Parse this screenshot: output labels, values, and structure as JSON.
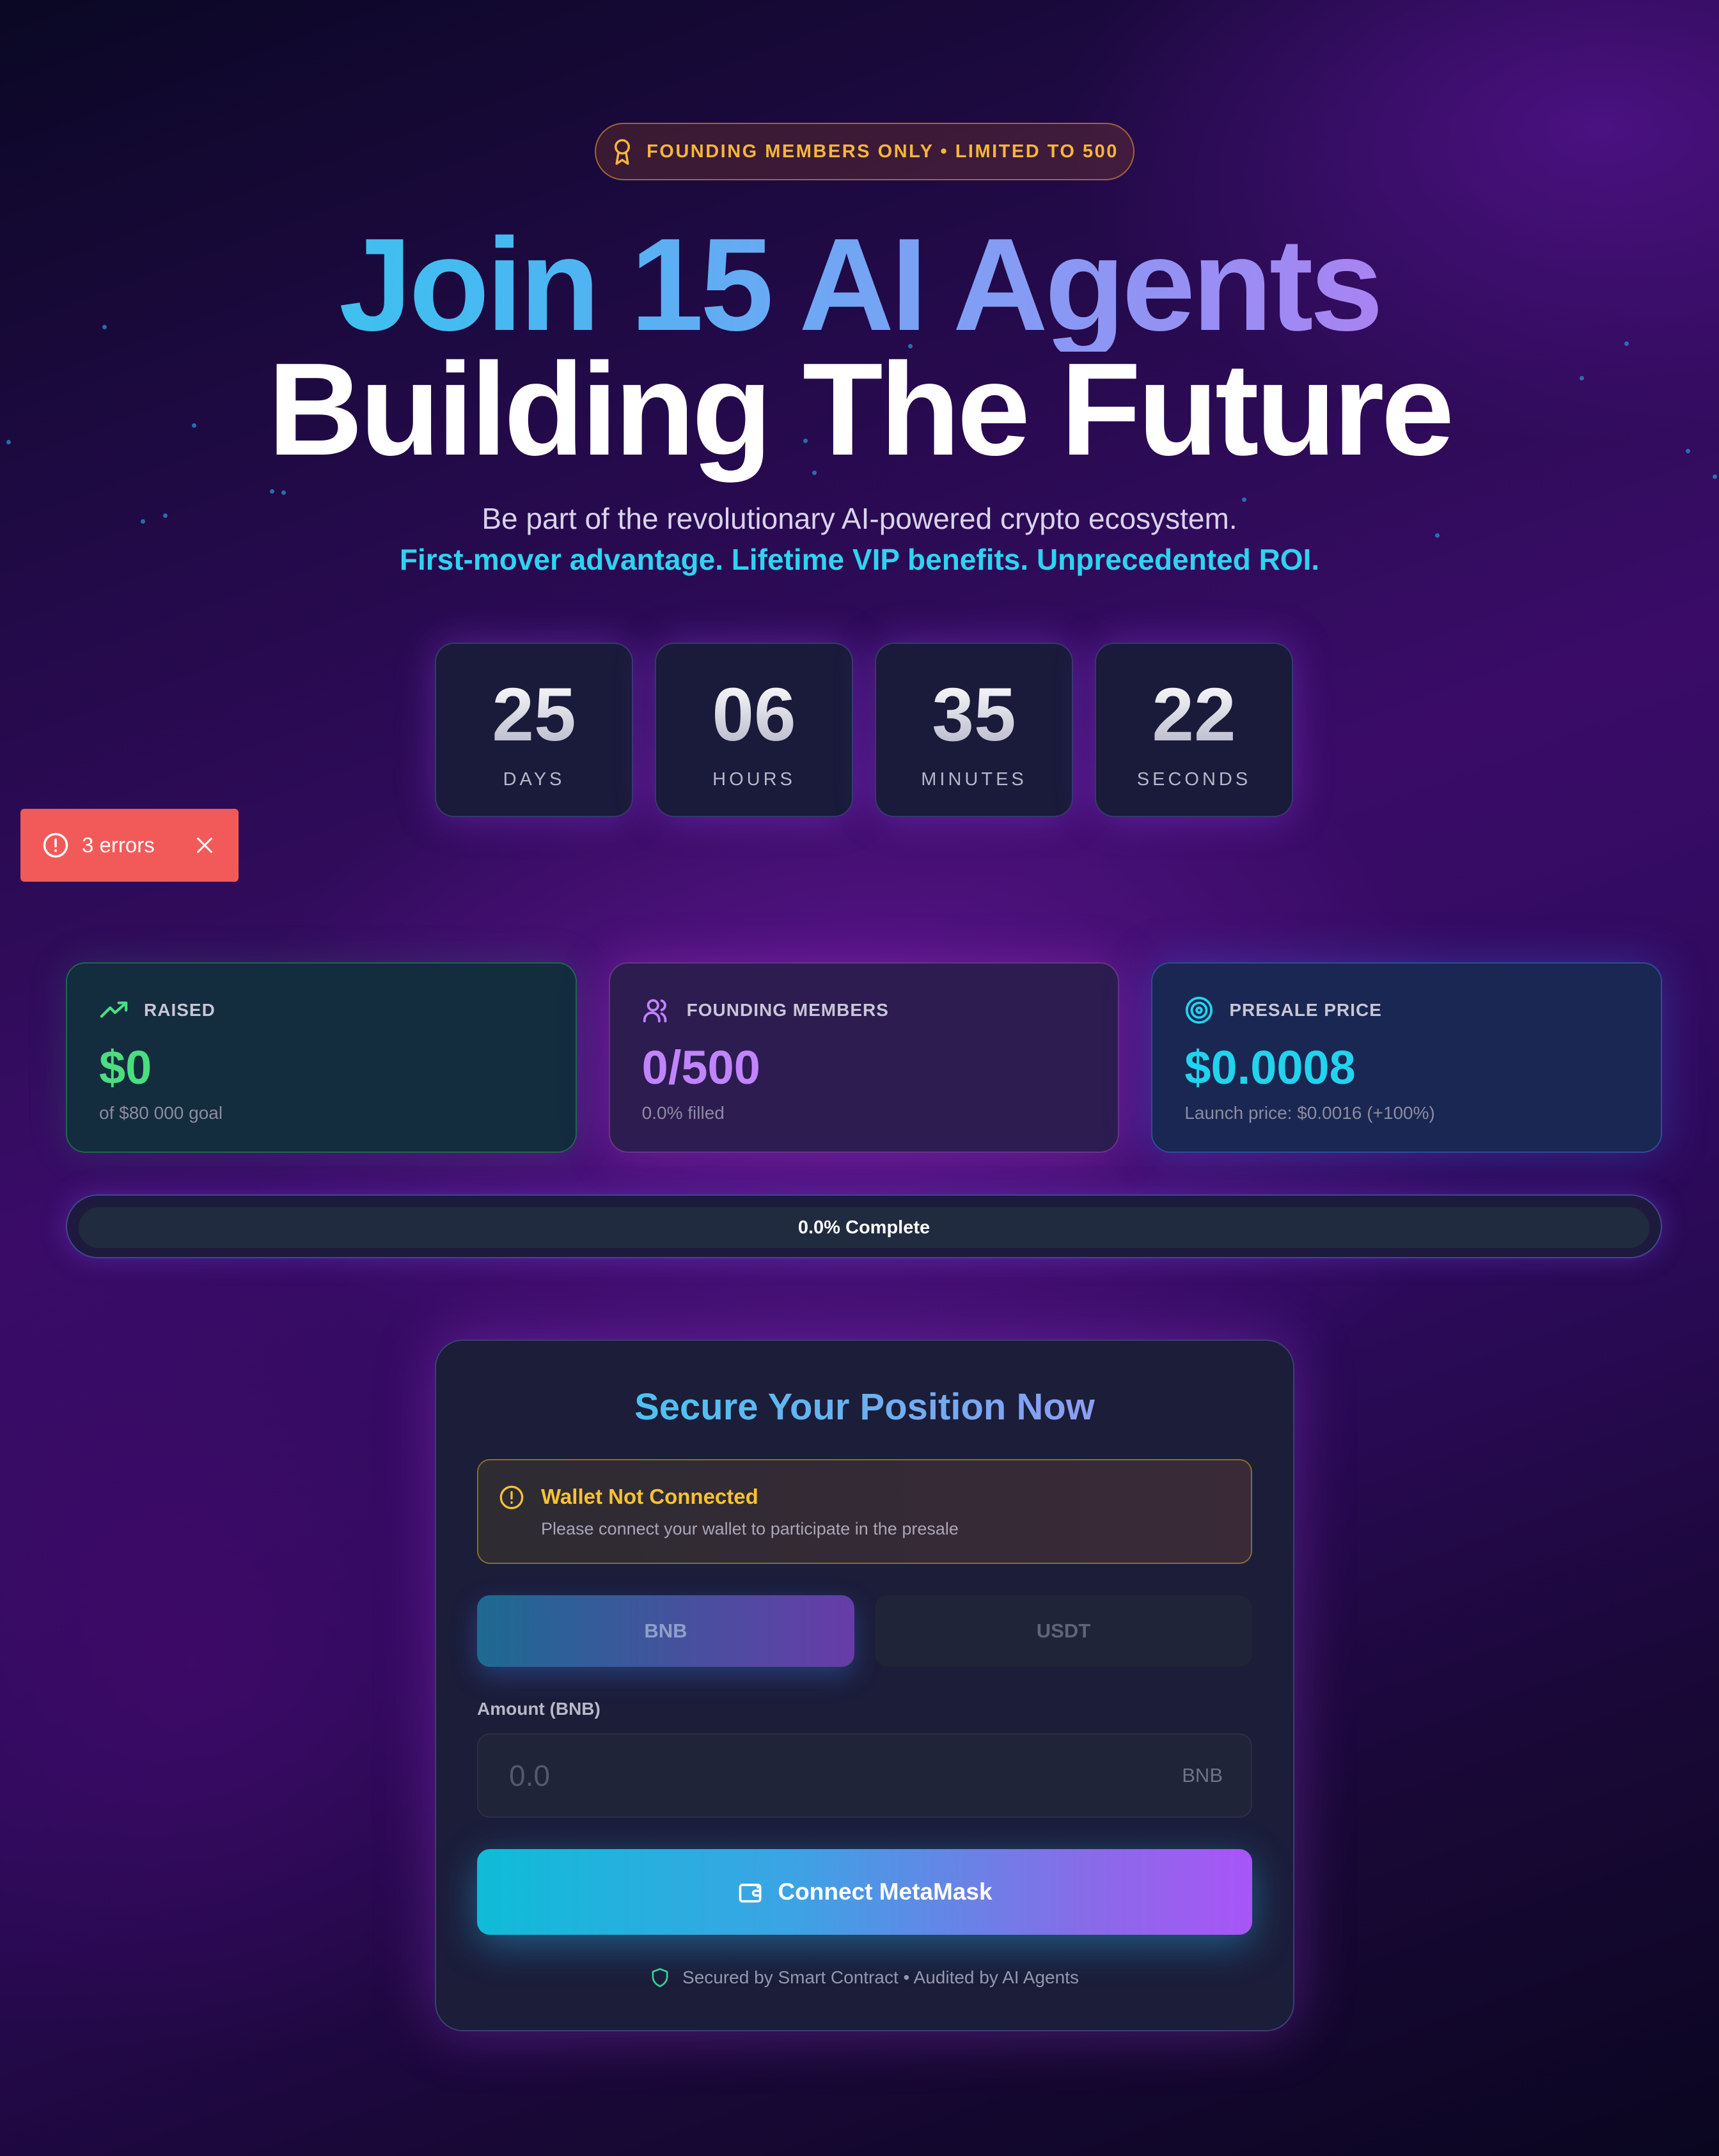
{
  "badge": {
    "text": "FOUNDING MEMBERS ONLY • LIMITED TO 500",
    "icon": "award-icon"
  },
  "hero": {
    "line1": "Join 15 AI Agents",
    "line2": "Building The Future",
    "subtitle": "Be part of the revolutionary AI-powered crypto ecosystem.",
    "tagline": "First-mover advantage. Lifetime VIP benefits. Unprecedented ROI."
  },
  "countdown": [
    {
      "value": "25",
      "label": "DAYS"
    },
    {
      "value": "06",
      "label": "HOURS"
    },
    {
      "value": "35",
      "label": "MINUTES"
    },
    {
      "value": "22",
      "label": "SECONDS"
    }
  ],
  "error_toast": {
    "text": "3 errors",
    "icon": "alert-circle-icon",
    "close_icon": "close-icon"
  },
  "stats": [
    {
      "label": "RAISED",
      "value": "$0",
      "sub": "of $80 000 goal",
      "icon": "trending-up-icon",
      "color": "#4ade80"
    },
    {
      "label": "FOUNDING MEMBERS",
      "value": "0/500",
      "sub": "0.0% filled",
      "icon": "users-icon",
      "color": "#c084fc"
    },
    {
      "label": "PRESALE PRICE",
      "value": "$0.0008",
      "sub": "Launch price: $0.0016 (+100%)",
      "icon": "target-icon",
      "color": "#22d3ee"
    }
  ],
  "progress": {
    "text": "0.0% Complete",
    "fraction": 0.0
  },
  "panel": {
    "title": "Secure Your Position Now",
    "warning_title": "Wallet Not Connected",
    "warning_text": "Please connect your wallet to participate in the presale",
    "tabs": [
      "BNB",
      "USDT"
    ],
    "selected_tab": "BNB",
    "amount_label": "Amount (BNB)",
    "amount_placeholder": "0.0",
    "amount_unit": "BNB",
    "connect_label": "Connect MetaMask",
    "secured_text": "Secured by Smart Contract • Audited by AI Agents"
  },
  "colors": {
    "accent_cyan": "#22d3ee",
    "accent_purple": "#a855f7",
    "error_red": "#f25a5a",
    "warning_yellow": "#f6c233"
  }
}
